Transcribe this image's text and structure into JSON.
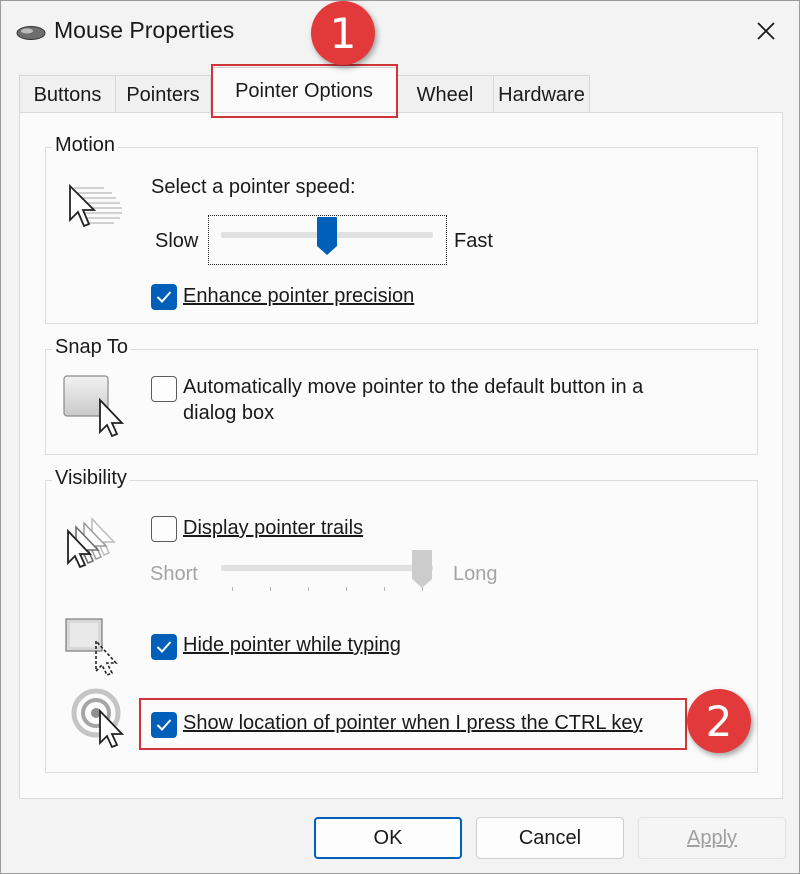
{
  "window": {
    "title": "Mouse Properties"
  },
  "tabs": [
    {
      "label": "Buttons"
    },
    {
      "label": "Pointers"
    },
    {
      "label": "Pointer Options",
      "active": true
    },
    {
      "label": "Wheel"
    },
    {
      "label": "Hardware"
    }
  ],
  "motion": {
    "group_label": "Motion",
    "speed_label": "Select a pointer speed:",
    "slow_label": "Slow",
    "fast_label": "Fast",
    "speed_fraction": 0.5,
    "enhance_label": "Enhance pointer precision",
    "enhance_checked": true
  },
  "snap": {
    "group_label": "Snap To",
    "auto_move_label_line1": "Automatically move pointer to the default button in a",
    "auto_move_label_line2": "dialog box",
    "auto_move_checked": false
  },
  "visibility": {
    "group_label": "Visibility",
    "trails_label": "Display pointer trails",
    "trails_checked": false,
    "short_label": "Short",
    "long_label": "Long",
    "trails_fraction": 1.0,
    "hide_label": "Hide pointer while typing",
    "hide_checked": true,
    "show_location_label": "Show location of pointer when I press the CTRL key",
    "show_location_checked": true
  },
  "buttons": {
    "ok": "OK",
    "cancel": "Cancel",
    "apply": "Apply"
  },
  "annotations": {
    "badge1": "1",
    "badge2": "2"
  },
  "colors": {
    "accent": "#005fb8",
    "annotation_red": "#e23a3a"
  }
}
